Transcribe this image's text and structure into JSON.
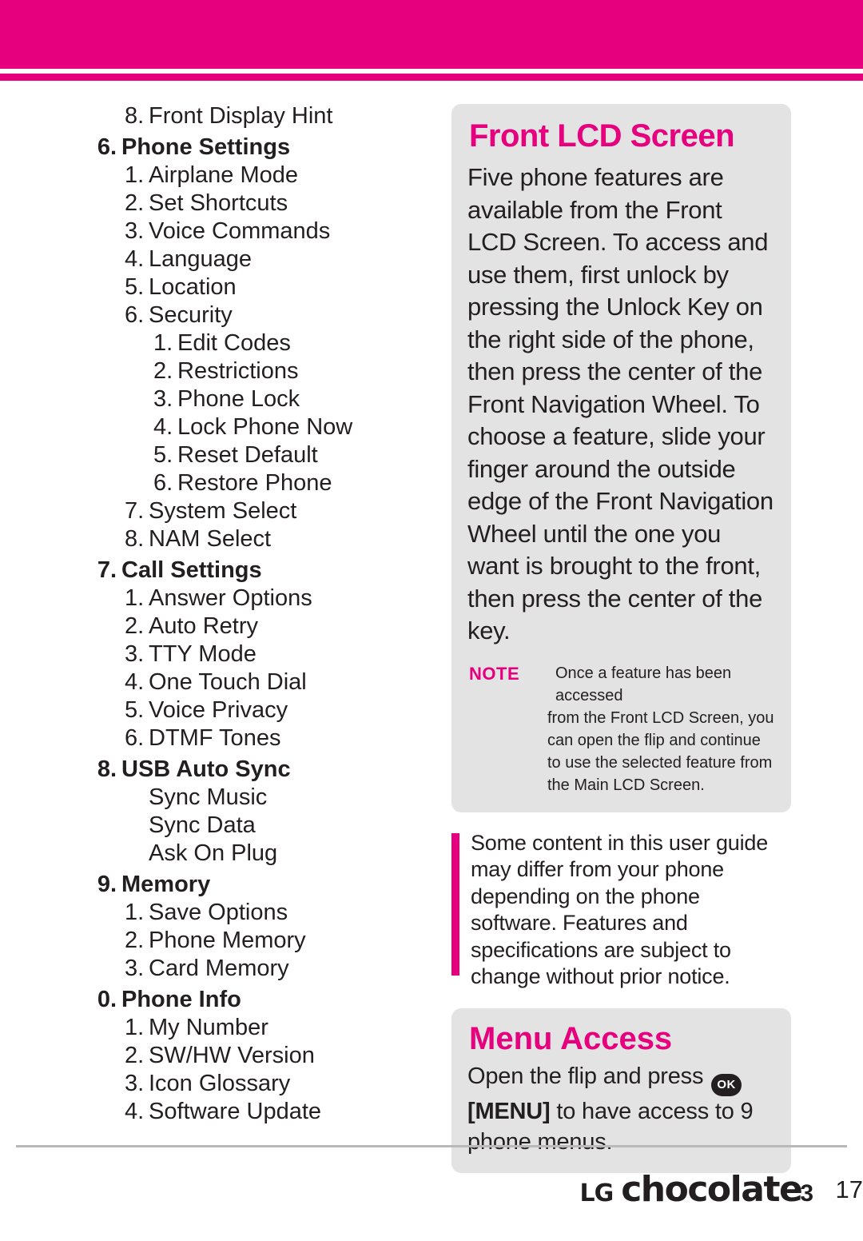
{
  "page": {
    "number": "17",
    "brand_lg": "LG",
    "brand_product": "chocolate",
    "brand_superscript": "3"
  },
  "toc": {
    "items": [
      {
        "level": 1,
        "num": "8.",
        "label": "Front Display Hint",
        "bold": false
      },
      {
        "level": 0,
        "num": "6.",
        "label": "Phone Settings",
        "bold": true
      },
      {
        "level": 1,
        "num": "1.",
        "label": "Airplane Mode",
        "bold": false
      },
      {
        "level": 1,
        "num": "2.",
        "label": "Set Shortcuts",
        "bold": false
      },
      {
        "level": 1,
        "num": "3.",
        "label": "Voice Commands",
        "bold": false
      },
      {
        "level": 1,
        "num": "4.",
        "label": "Language",
        "bold": false
      },
      {
        "level": 1,
        "num": "5.",
        "label": "Location",
        "bold": false
      },
      {
        "level": 1,
        "num": "6.",
        "label": "Security",
        "bold": false
      },
      {
        "level": 2,
        "num": "1.",
        "label": "Edit Codes",
        "bold": false
      },
      {
        "level": 2,
        "num": "2.",
        "label": "Restrictions",
        "bold": false
      },
      {
        "level": 2,
        "num": "3.",
        "label": "Phone Lock",
        "bold": false
      },
      {
        "level": 2,
        "num": "4.",
        "label": "Lock Phone Now",
        "bold": false
      },
      {
        "level": 2,
        "num": "5.",
        "label": "Reset Default",
        "bold": false
      },
      {
        "level": 2,
        "num": "6.",
        "label": "Restore Phone",
        "bold": false
      },
      {
        "level": 1,
        "num": "7.",
        "label": "System Select",
        "bold": false
      },
      {
        "level": 1,
        "num": "8.",
        "label": "NAM Select",
        "bold": false
      },
      {
        "level": 0,
        "num": "7.",
        "label": "Call Settings",
        "bold": true
      },
      {
        "level": 1,
        "num": "1.",
        "label": "Answer Options",
        "bold": false
      },
      {
        "level": 1,
        "num": "2.",
        "label": "Auto Retry",
        "bold": false
      },
      {
        "level": 1,
        "num": "3.",
        "label": "TTY Mode",
        "bold": false
      },
      {
        "level": 1,
        "num": "4.",
        "label": "One Touch Dial",
        "bold": false
      },
      {
        "level": 1,
        "num": "5.",
        "label": "Voice Privacy",
        "bold": false
      },
      {
        "level": 1,
        "num": "6.",
        "label": "DTMF Tones",
        "bold": false
      },
      {
        "level": 0,
        "num": "8.",
        "label": "USB Auto Sync",
        "bold": true
      },
      {
        "level": 1,
        "num": "",
        "label": "Sync Music",
        "bold": false
      },
      {
        "level": 1,
        "num": "",
        "label": "Sync Data",
        "bold": false
      },
      {
        "level": 1,
        "num": "",
        "label": "Ask On Plug",
        "bold": false
      },
      {
        "level": 0,
        "num": "9.",
        "label": "Memory",
        "bold": true
      },
      {
        "level": 1,
        "num": "1.",
        "label": "Save Options",
        "bold": false
      },
      {
        "level": 1,
        "num": "2.",
        "label": "Phone Memory",
        "bold": false
      },
      {
        "level": 1,
        "num": "3.",
        "label": "Card Memory",
        "bold": false
      },
      {
        "level": 0,
        "num": "0.",
        "label": "Phone Info",
        "bold": true
      },
      {
        "level": 1,
        "num": "1.",
        "label": "My Number",
        "bold": false
      },
      {
        "level": 1,
        "num": "2.",
        "label": "SW/HW Version",
        "bold": false
      },
      {
        "level": 1,
        "num": "3.",
        "label": "Icon Glossary",
        "bold": false
      },
      {
        "level": 1,
        "num": "4.",
        "label": "Software Update",
        "bold": false
      }
    ]
  },
  "front_lcd": {
    "title": "Front LCD Screen",
    "body": "Five phone features are available from the Front LCD Screen. To access and use them, first unlock by pressing the Unlock Key on the right side of the phone, then press the center of the Front Navigation Wheel. To choose a feature, slide your finger around the outside edge of the Front Navigation Wheel until the one you want is brought to the front, then press the center of the key.",
    "note_label": "NOTE",
    "note_first_line": "Once a feature has been accessed",
    "note_rest": "from the Front LCD Screen, you can open the flip and continue to use the selected feature from the Main LCD Screen."
  },
  "disclaimer": {
    "text": "Some content in this user guide may differ from your phone depending on the phone software. Features and specifications are subject to change without prior notice."
  },
  "menu_access": {
    "title": "Menu Access",
    "line1": "Open the flip and press",
    "ok_key": "OK",
    "line2_bold": "[MENU]",
    "line2_rest": "to have access to 9 phone menus."
  },
  "colors": {
    "accent": "#e6007e",
    "panel_bg": "#e3e3e3",
    "text": "#231f20"
  }
}
